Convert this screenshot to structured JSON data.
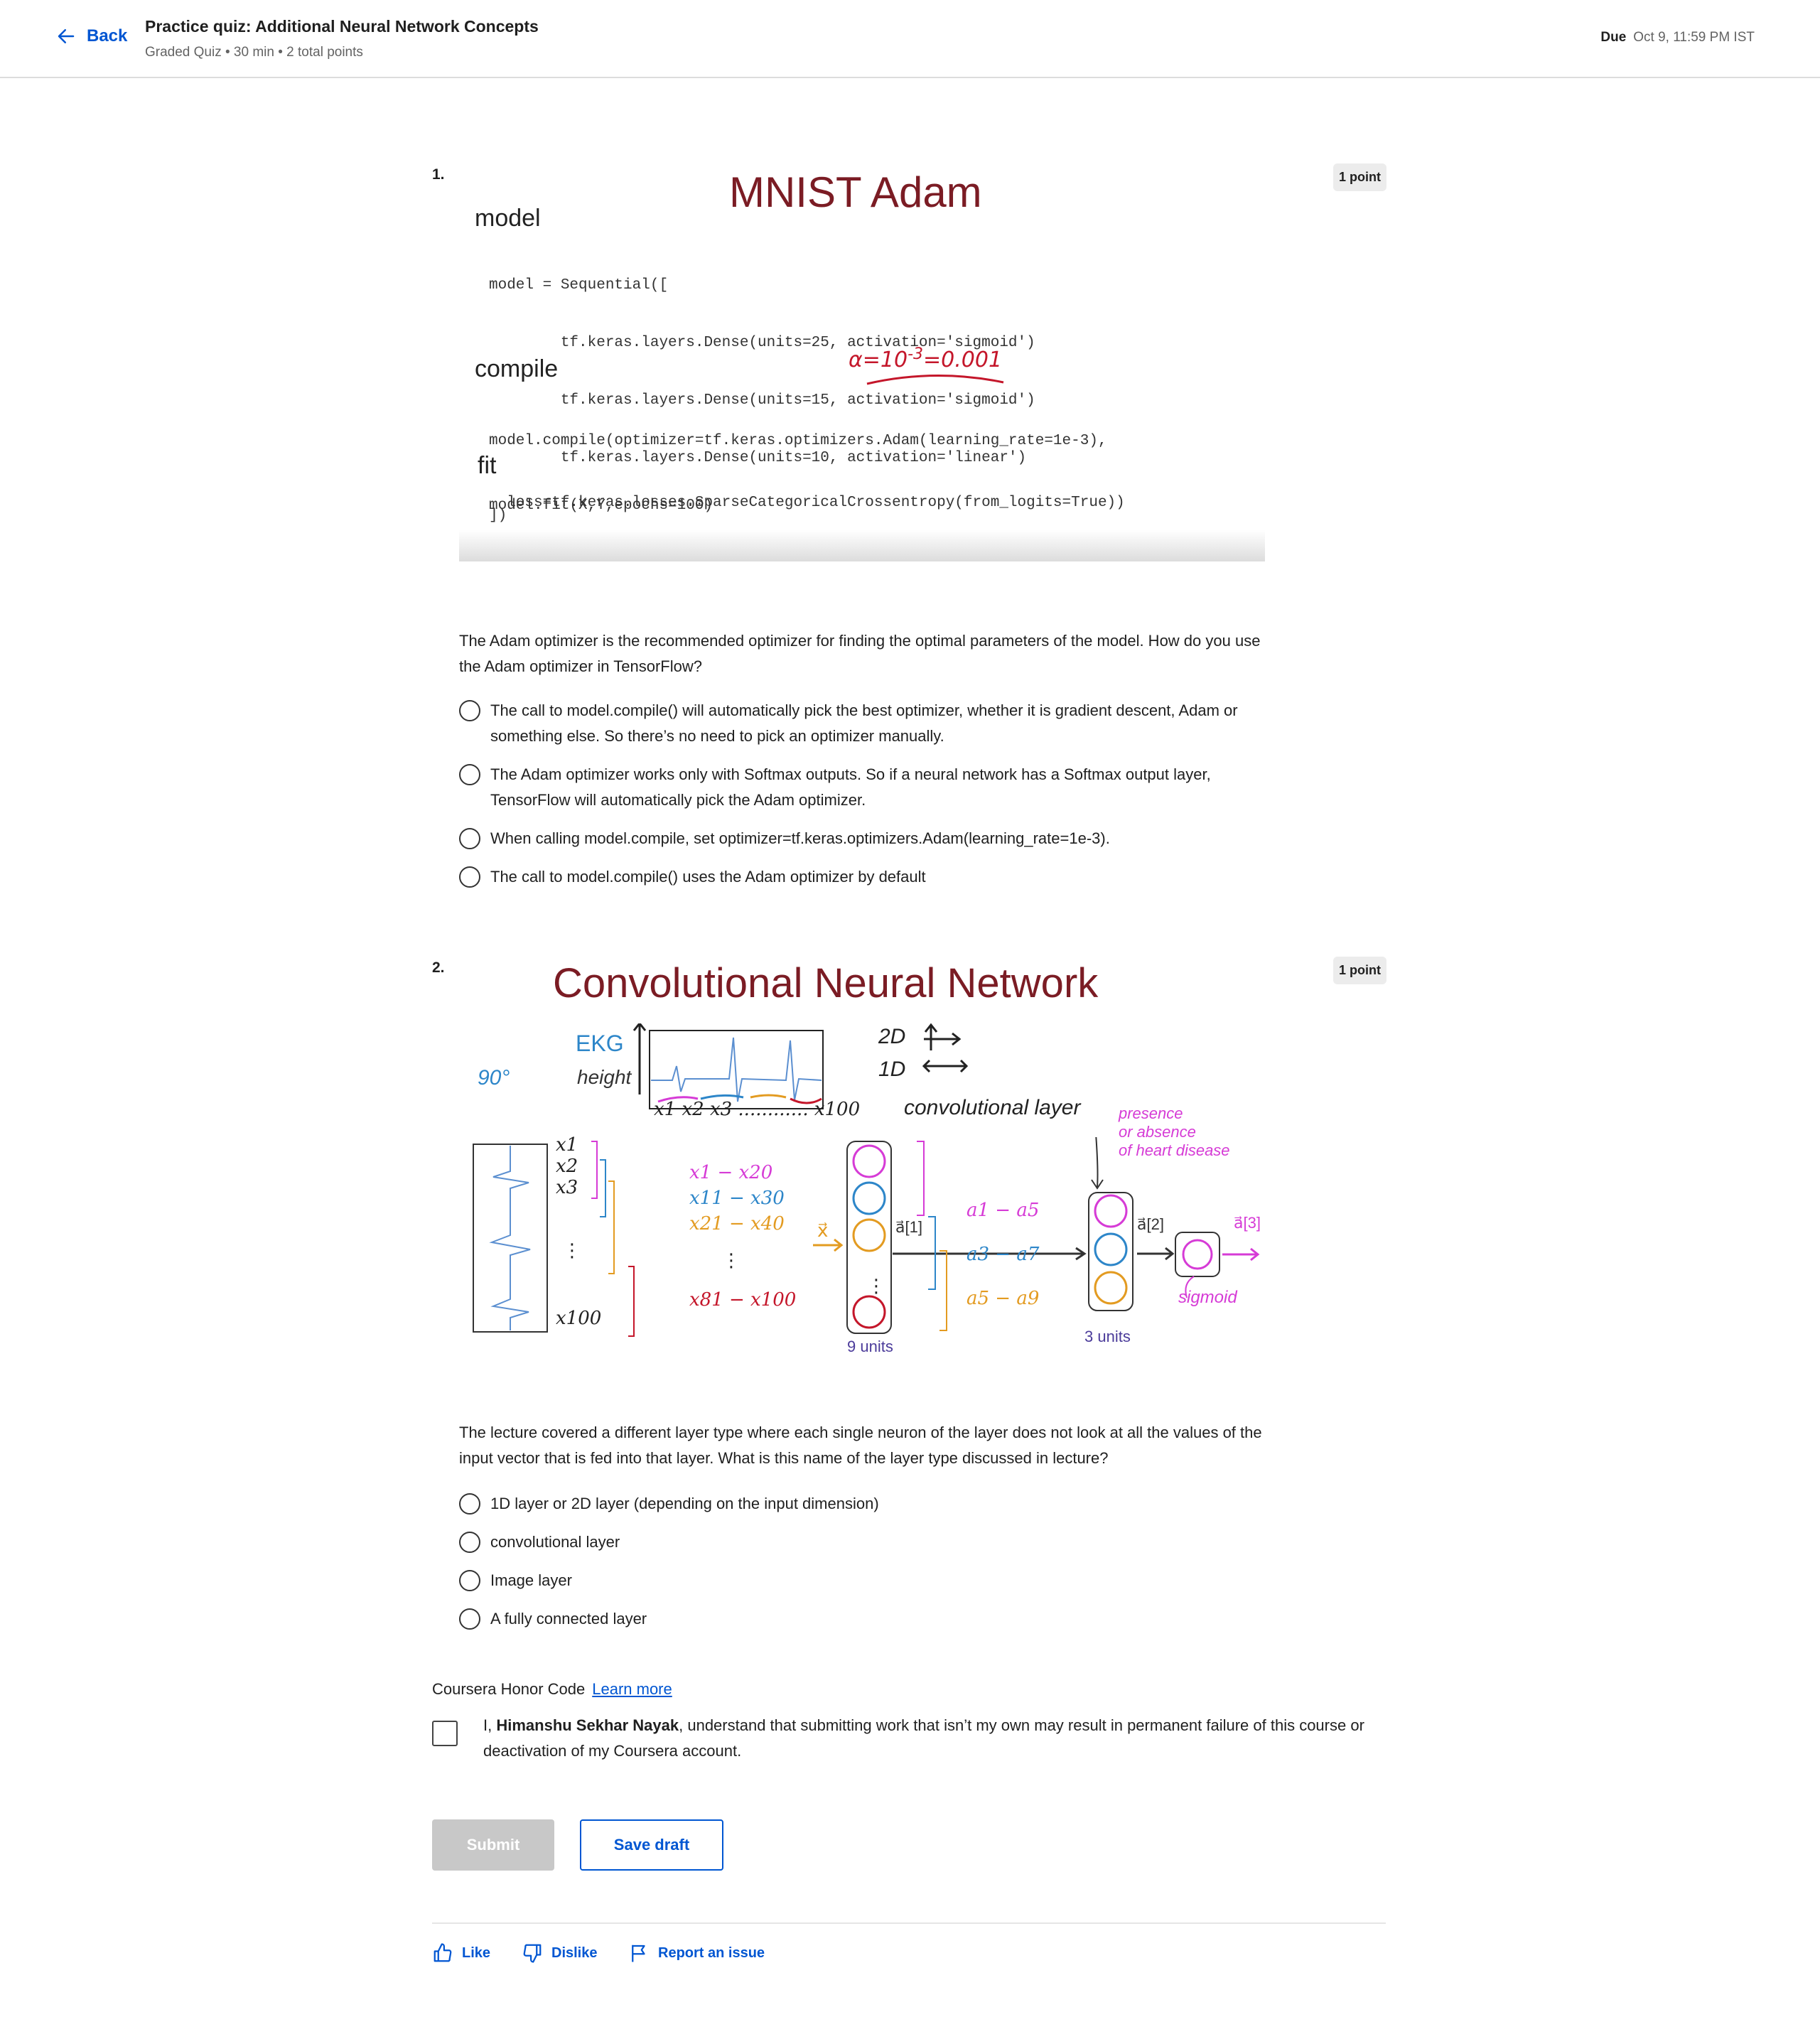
{
  "header": {
    "back_label": "Back",
    "title": "Practice quiz: Additional Neural Network Concepts",
    "subtitle": "Graded Quiz • 30 min • 2 total points",
    "due_label": "Due",
    "due_value": "Oct 9, 11:59 PM IST"
  },
  "q1": {
    "number": "1.",
    "points": "1 point",
    "figure": {
      "title": "MNIST Adam",
      "model_heading": "model",
      "code_model": [
        "model = Sequential([",
        "        tf.keras.layers.Dense(units=25, activation='sigmoid')",
        "        tf.keras.layers.Dense(units=15, activation='sigmoid')",
        "        tf.keras.layers.Dense(units=10, activation='linear')",
        "])"
      ],
      "compile_heading": "compile",
      "handwritten": "α=10",
      "handwritten_exp": "-3",
      "handwritten_tail": "=0.001",
      "code_compile": [
        "model.compile(optimizer=tf.keras.optimizers.Adam(learning_rate=1e-3),",
        "  loss=tf.keras.losses.SparseCategoricalCrossentropy(from_logits=True))"
      ],
      "fit_heading": "fit",
      "code_fit": "model.fit(X,Y,epochs=100)"
    },
    "question": "The Adam optimizer is the recommended optimizer for finding the optimal parameters of the model. How do you use the Adam optimizer in TensorFlow?",
    "options": [
      "The call to model.compile() will automatically pick the best optimizer, whether it is gradient descent, Adam or something else. So there’s no need to pick an optimizer manually.",
      "The Adam optimizer works only with Softmax outputs. So if a neural network has a Softmax output layer, TensorFlow will automatically pick the Adam optimizer.",
      "When calling model.compile, set optimizer=tf.keras.optimizers.Adam(learning_rate=1e-3).",
      "The call to model.compile() uses the Adam optimizer by default"
    ]
  },
  "q2": {
    "number": "2.",
    "points": "1 point",
    "figure": {
      "title": "Convolutional Neural Network",
      "ekg": "EKG",
      "height": "height",
      "deg": "90°",
      "two_d": "2D",
      "one_d": "1D",
      "x_axis": "x1 x2 x3 ............ x100",
      "conv_label": "convolutional layer",
      "presence": "presence",
      "absence": "or absence",
      "heart": "of heart disease",
      "inputs_top": [
        "x1",
        "x2",
        "x3"
      ],
      "input_bottom": "x100",
      "ranges": [
        "x1 − x20",
        "x11 − x30",
        "x21 − x40"
      ],
      "range_last": "x81 − x100",
      "x_vec": "x⃗",
      "a1": "a⃗[1]",
      "a2": "a⃗[2]",
      "a3": "a⃗[3]",
      "act_ranges": [
        "a1 − a5",
        "a3 − a7",
        "a5 − a9"
      ],
      "nine_units": "9 units",
      "three_units": "3 units",
      "sigmoid": "sigmoid"
    },
    "question": "The lecture covered a different layer type where each single neuron of the layer does not look at all the values of the input vector that is fed into that layer. What is this name of the layer type discussed in lecture?",
    "options": [
      "1D layer or 2D layer (depending on the input dimension)",
      "convolutional layer",
      "Image layer",
      "A fully connected layer"
    ]
  },
  "honor": {
    "title": "Coursera Honor Code",
    "learn_more": "Learn more",
    "prefix": "I, ",
    "name": "Himanshu Sekhar Nayak",
    "text": ", understand that submitting work that isn’t my own may result in permanent failure of this course or deactivation of my Coursera account."
  },
  "actions": {
    "submit": "Submit",
    "save_draft": "Save draft"
  },
  "footer": {
    "like": "Like",
    "dislike": "Dislike",
    "report": "Report an issue"
  }
}
